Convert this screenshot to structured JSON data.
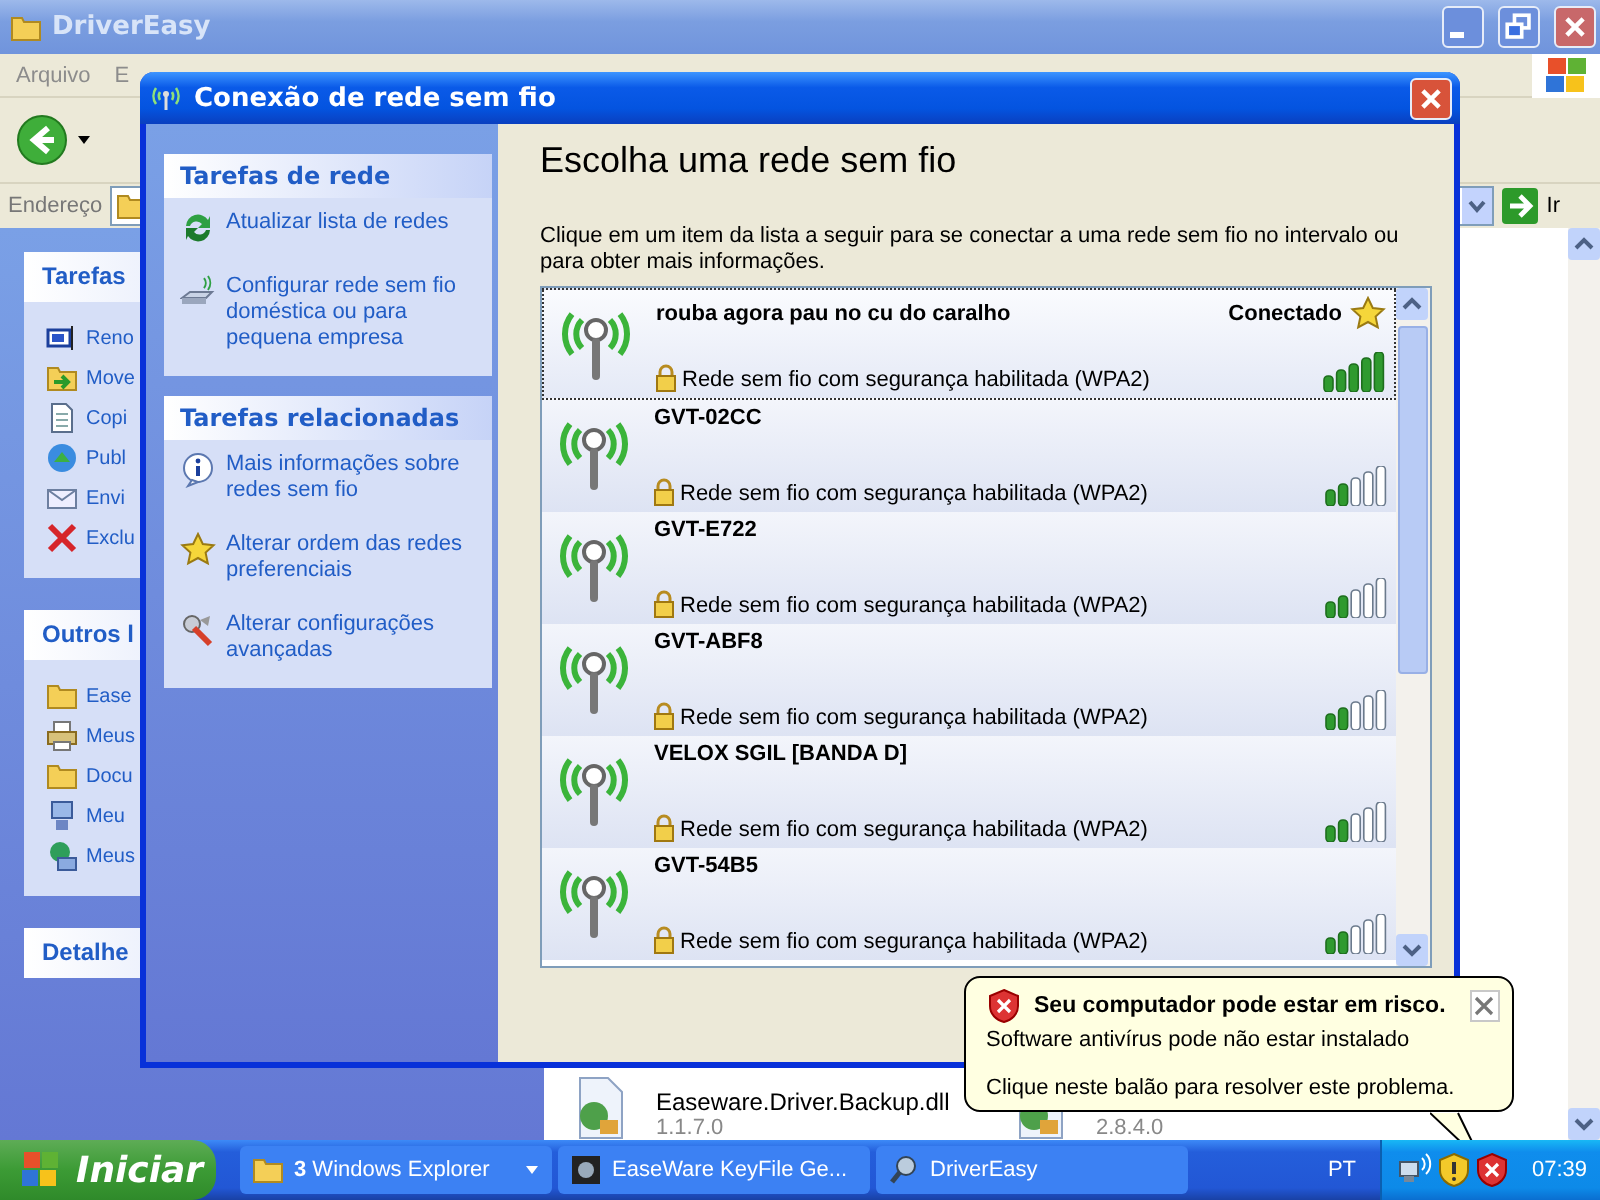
{
  "explorer": {
    "title": "DriverEasy",
    "menu": [
      "Arquivo",
      "E"
    ],
    "address_label": "Endereço",
    "go_button": "Ir",
    "task_panels": [
      {
        "title": "Tarefas",
        "items": [
          {
            "label": "Reno",
            "kind": "textfield"
          },
          {
            "label": "Move",
            "kind": "folder-arrow"
          },
          {
            "label": "Copi",
            "kind": "document"
          },
          {
            "label": "Publ",
            "kind": "globe"
          },
          {
            "label": "Envi",
            "kind": "envelope"
          },
          {
            "label": "Exclu",
            "kind": "cross"
          }
        ]
      },
      {
        "title": "Outros l",
        "items": [
          {
            "label": "Ease",
            "kind": "folder"
          },
          {
            "label": "Meus",
            "kind": "printer"
          },
          {
            "label": "Docu",
            "kind": "folder"
          },
          {
            "label": "Meu",
            "kind": "computer"
          },
          {
            "label": "Meus",
            "kind": "network"
          }
        ]
      },
      {
        "title": "Detalhe"
      }
    ],
    "files": [
      {
        "name": "Easeware.Driver.Backup.dll",
        "version": "1.1.7.0"
      },
      {
        "version": "2.8.4.0"
      }
    ]
  },
  "dialog": {
    "title": "Conexão de rede sem fio",
    "sidebar": [
      {
        "title": "Tarefas de rede",
        "items": [
          {
            "label": "Atualizar lista de redes",
            "kind": "refresh"
          },
          {
            "label": "Configurar rede sem fio doméstica ou para pequena empresa",
            "kind": "router"
          }
        ]
      },
      {
        "title": "Tarefas relacionadas",
        "items": [
          {
            "label": "Mais informações sobre redes sem fio",
            "kind": "info"
          },
          {
            "label": "Alterar ordem das redes preferenciais",
            "kind": "star"
          },
          {
            "label": "Alterar configurações avançadas",
            "kind": "wrench"
          }
        ]
      }
    ],
    "heading": "Escolha uma rede sem fio",
    "description": "Clique em um item da lista a seguir para se conectar a uma rede sem fio no intervalo ou para obter mais informações.",
    "networks": [
      {
        "name": "rouba agora pau no cu do caralho",
        "status": "Conectado",
        "security": "Rede sem fio com segurança habilitada (WPA2)",
        "level": 1,
        "selected": true
      },
      {
        "name": "GVT-02CC",
        "security": "Rede sem fio com segurança habilitada (WPA2)",
        "level": 0.4,
        "selected": false
      },
      {
        "name": "GVT-E722",
        "security": "Rede sem fio com segurança habilitada (WPA2)",
        "level": 0.4,
        "selected": false
      },
      {
        "name": "GVT-ABF8",
        "security": "Rede sem fio com segurança habilitada (WPA2)",
        "level": 0.4,
        "selected": false
      },
      {
        "name": "VELOX SGIL [BANDA D]",
        "security": "Rede sem fio com segurança habilitada (WPA2)",
        "level": 0.4,
        "selected": false
      },
      {
        "name": "GVT-54B5",
        "security": "Rede sem fio com segurança habilitada (WPA2)",
        "level": 0.4,
        "selected": false
      }
    ]
  },
  "balloon": {
    "title": "Seu computador pode estar em risco.",
    "lines": [
      "Software antivírus pode não estar instalado",
      "Clique neste balão para resolver este problema."
    ]
  },
  "taskbar": {
    "start": "Iniciar",
    "tasks": [
      {
        "label": "**3** Windows Explorer",
        "kind": "folder",
        "has_menu": true
      },
      {
        "label": "EaseWare KeyFile Ge...",
        "kind": "app"
      },
      {
        "label": "DriverEasy",
        "kind": "search"
      }
    ],
    "language": "PT",
    "clock": "07:39"
  }
}
